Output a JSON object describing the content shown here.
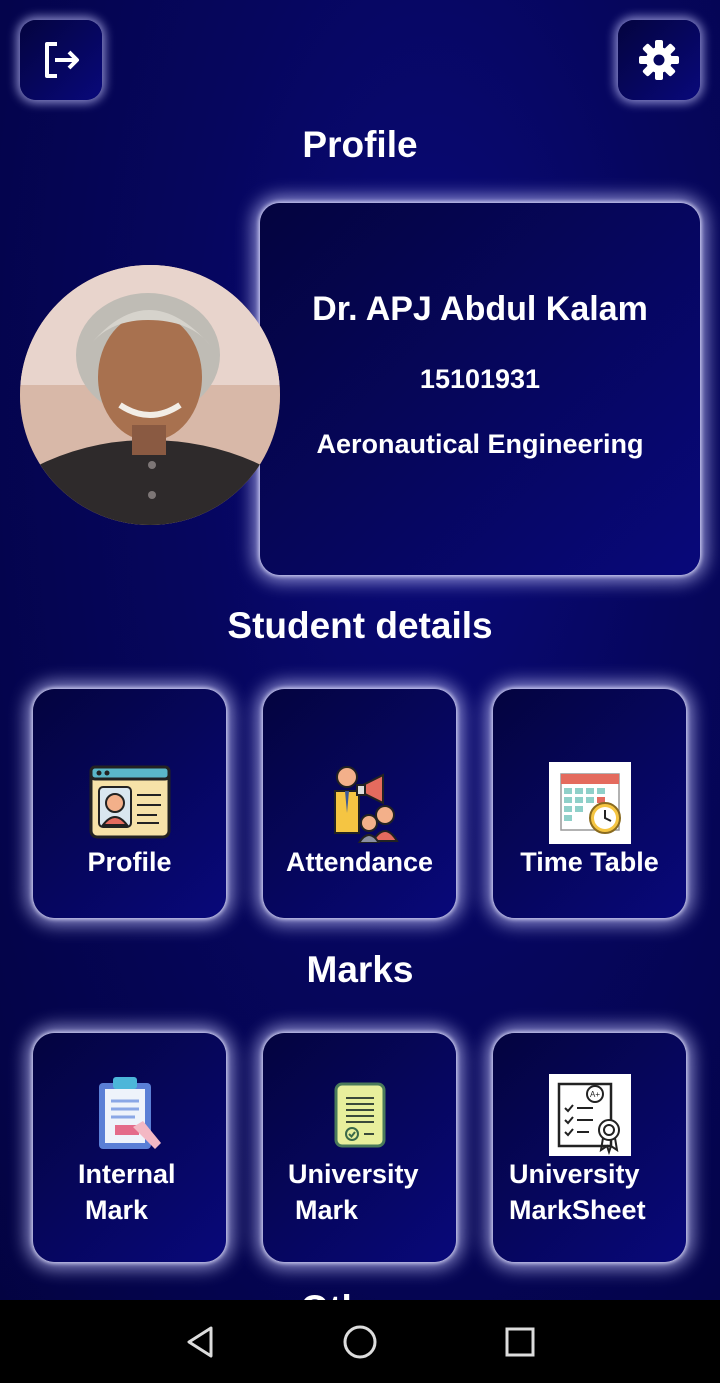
{
  "header": {
    "logout_icon": "logout-icon",
    "settings_icon": "gear-icon"
  },
  "profile_section": {
    "title": "Profile",
    "name": "Dr. APJ Abdul Kalam",
    "id": "15101931",
    "department": "Aeronautical Engineering"
  },
  "student_details": {
    "title": "Student details",
    "tiles": [
      {
        "label": "Profile",
        "icon": "profile-card-icon"
      },
      {
        "label": "Attendance",
        "icon": "attendance-icon"
      },
      {
        "label": "Time Table",
        "icon": "calendar-clock-icon"
      }
    ]
  },
  "marks": {
    "title": "Marks",
    "tiles": [
      {
        "label_line1": "Internal",
        "label_line2": "Mark",
        "icon": "clipboard-icon"
      },
      {
        "label_line1": "University",
        "label_line2": "Mark",
        "icon": "document-check-icon"
      },
      {
        "label_line1": "University",
        "label_line2": "MarkSheet",
        "icon": "certificate-icon"
      }
    ]
  },
  "next_section": {
    "title_partial": "Others"
  },
  "colors": {
    "background": "#06065e",
    "card": "#08087a",
    "glow": "#c8c8ff"
  }
}
